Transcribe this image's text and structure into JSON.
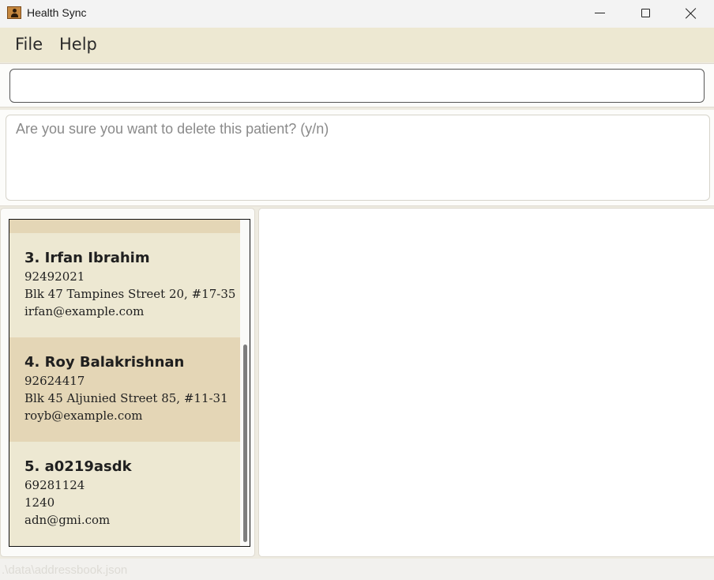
{
  "window": {
    "title": "Health Sync",
    "icon": "address-book-icon"
  },
  "menu": {
    "items": [
      "File",
      "Help"
    ]
  },
  "command": {
    "value": "",
    "placeholder": ""
  },
  "result": {
    "text": "Are you sure you want to delete this patient? (y/n)"
  },
  "persons": [
    {
      "name": "3. Irfan Ibrahim",
      "phone": "92492021",
      "address": "Blk 47 Tampines Street 20, #17-35",
      "email": "irfan@example.com"
    },
    {
      "name": "4. Roy Balakrishnan",
      "phone": "92624417",
      "address": "Blk 45 Aljunied Street 85, #11-31",
      "email": "royb@example.com"
    },
    {
      "name": "5. a0219asdk",
      "phone": "69281124",
      "address": "1240",
      "email": "adn@gmi.com"
    }
  ],
  "status": {
    "path": ".\\data\\addressbook.json"
  },
  "colors": {
    "menu_bg": "#ede8d2",
    "card_odd": "#ede8d2",
    "card_even": "#e4d6b6"
  }
}
